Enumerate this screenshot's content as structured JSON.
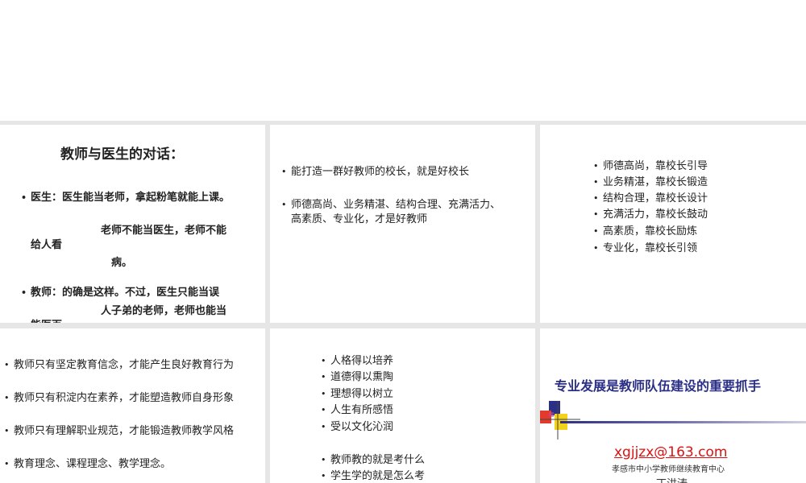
{
  "slide1": {
    "title": "教师与医生的对话：",
    "b1_line1": "医生：医生能当老师，拿起粉笔就能上课。",
    "b1_line2": "老师不能当医生，老师不能",
    "b1_line3": "给人看",
    "b1_line4": "病。",
    "b2_line1": "教师：的确是这样。不过，医生只能当误",
    "b2_line2": "人子弟的老师，老师也能当",
    "b2_line3": "能医百"
  },
  "slide2": {
    "b1": "能打造一群好教师的校长，就是好校长",
    "b2_line1": "师德高尚、业务精湛、结构合理、充满活力、",
    "b2_line2": "高素质、专业化，才是好教师"
  },
  "slide3": {
    "items": [
      "师德高尚，靠校长引导",
      "业务精湛，靠校长锻造",
      "结构合理，靠校长设计",
      "充满活力，靠校长鼓动",
      "高素质，靠校长励炼",
      "专业化，靠校长引领"
    ]
  },
  "slide4": {
    "items": [
      "教师只有坚定教育信念，才能产生良好教育行为",
      "教师只有积淀内在素养，才能塑造教师自身形象",
      "教师只有理解职业规范，才能锻造教师教学风格",
      "教育理念、课程理念、教学理念。"
    ]
  },
  "slide5": {
    "items": [
      "人格得以培养",
      "道德得以熏陶",
      "理想得以树立",
      "人生有所感悟",
      "受以文化沁润"
    ],
    "items2": [
      "教师教的就是考什么",
      "学生学的就是怎么考"
    ]
  },
  "slide6": {
    "title": "专业发展是教师队伍建设的重要抓手",
    "email": "xgjjzx@163.com",
    "org": "孝感市中小学教师继续教育中心",
    "name": "丁洪涛"
  },
  "colors": {
    "title_blue": "#2b2f86",
    "email_red": "#dd1111",
    "gap_gray": "#e6e6e6"
  }
}
